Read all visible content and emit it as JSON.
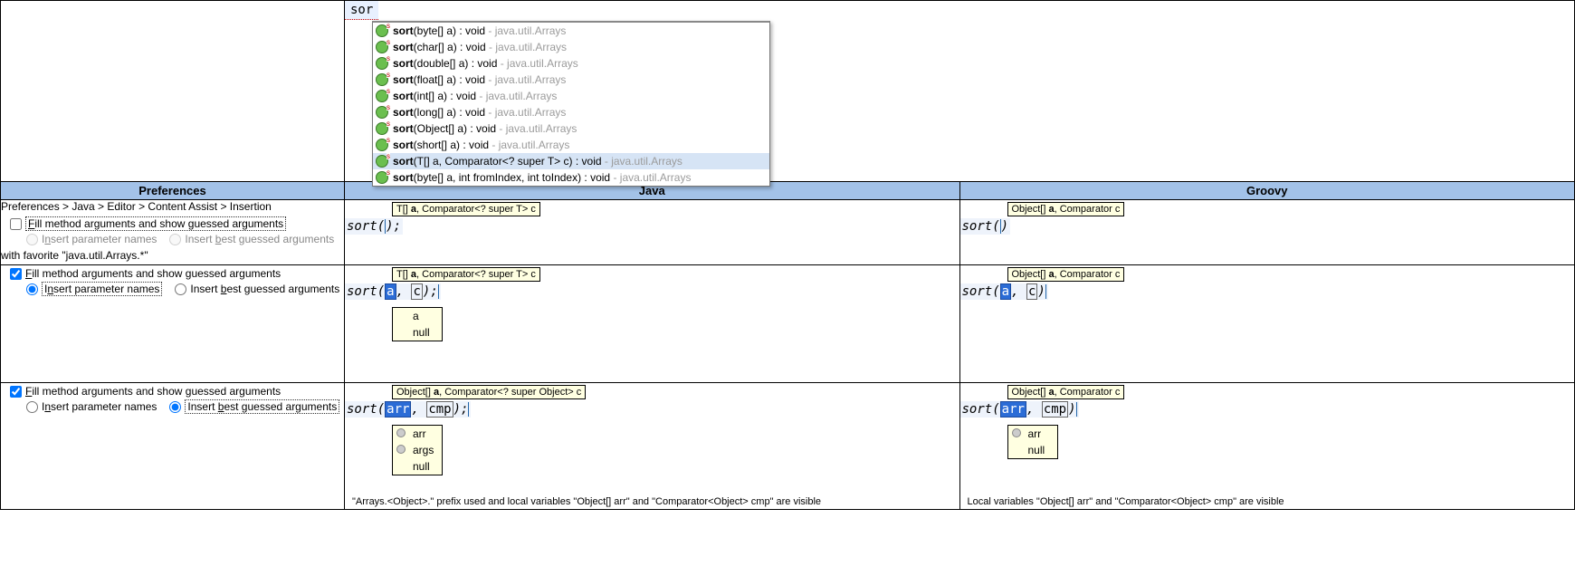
{
  "editor": {
    "typed": "sor",
    "assist": [
      {
        "sig": "sort(byte[] a) : void",
        "pkg": " - java.util.Arrays"
      },
      {
        "sig": "sort(char[] a) : void",
        "pkg": " - java.util.Arrays"
      },
      {
        "sig": "sort(double[] a) : void",
        "pkg": " - java.util.Arrays"
      },
      {
        "sig": "sort(float[] a) : void",
        "pkg": " - java.util.Arrays"
      },
      {
        "sig": "sort(int[] a) : void",
        "pkg": " - java.util.Arrays"
      },
      {
        "sig": "sort(long[] a) : void",
        "pkg": " - java.util.Arrays"
      },
      {
        "sig": "sort(Object[] a) : void",
        "pkg": " - java.util.Arrays"
      },
      {
        "sig": "sort(short[] a) : void",
        "pkg": " - java.util.Arrays"
      },
      {
        "sig": "sort(T[] a, Comparator<? super T> c) : void",
        "pkg": " - java.util.Arrays",
        "selected": true
      },
      {
        "sig": "sort(byte[] a, int fromIndex, int toIndex) : void",
        "pkg": " - java.util.Arrays"
      }
    ]
  },
  "headers": {
    "preferences": "Preferences",
    "java": "Java",
    "groovy": "Groovy"
  },
  "pref": {
    "path": "Preferences > Java > Editor > Content Assist > Insertion",
    "fill_label": "Fill method arguments and show guessed arguments",
    "insert_names": "Insert parameter names",
    "insert_best": "Insert best guessed arguments",
    "favorite": "with favorite \"java.util.Arrays.*\""
  },
  "row1": {
    "java_tooltip_pre": "T[] ",
    "java_tooltip_bold": "a",
    "java_tooltip_post": ", Comparator<? super T> c",
    "java_code": "sort();",
    "groovy_tooltip_pre": "Object[] ",
    "groovy_tooltip_bold": "a",
    "groovy_tooltip_post": ", Comparator c",
    "groovy_code": "sort()"
  },
  "row2": {
    "java_tooltip_pre": "T[] ",
    "java_tooltip_bold": "a",
    "java_tooltip_post": ", Comparator<? super T> c",
    "java_code_pre": "sort(",
    "java_p1": "a",
    "java_sep": ", ",
    "java_p2": "c",
    "java_code_post": ");",
    "proposals": [
      "a",
      "null"
    ],
    "groovy_tooltip_pre": "Object[] ",
    "groovy_tooltip_bold": "a",
    "groovy_tooltip_post": ", Comparator c",
    "groovy_code_pre": "sort(",
    "groovy_p1": "a",
    "groovy_sep": ", ",
    "groovy_p2": "c",
    "groovy_code_post": ")"
  },
  "row3": {
    "java_tooltip_pre": "Object[] ",
    "java_tooltip_bold": "a",
    "java_tooltip_post": ", Comparator<? super Object> c",
    "java_code_pre": "sort(",
    "java_p1": "arr",
    "java_sep": ", ",
    "java_p2": "cmp",
    "java_code_post": ");",
    "java_proposals": [
      "arr",
      "args",
      "null"
    ],
    "java_footnote": "\"Arrays.<Object>.\" prefix used and local variables \"Object[] arr\" and \"Comparator<Object> cmp\" are visible",
    "groovy_tooltip_pre": "Object[] ",
    "groovy_tooltip_bold": "a",
    "groovy_tooltip_post": ", Comparator c",
    "groovy_code_pre": "sort(",
    "groovy_p1": "arr",
    "groovy_sep": ", ",
    "groovy_p2": "cmp",
    "groovy_code_post": ")",
    "groovy_proposals": [
      "arr",
      "null"
    ],
    "groovy_footnote": "Local variables \"Object[] arr\" and \"Comparator<Object> cmp\" are visible"
  }
}
